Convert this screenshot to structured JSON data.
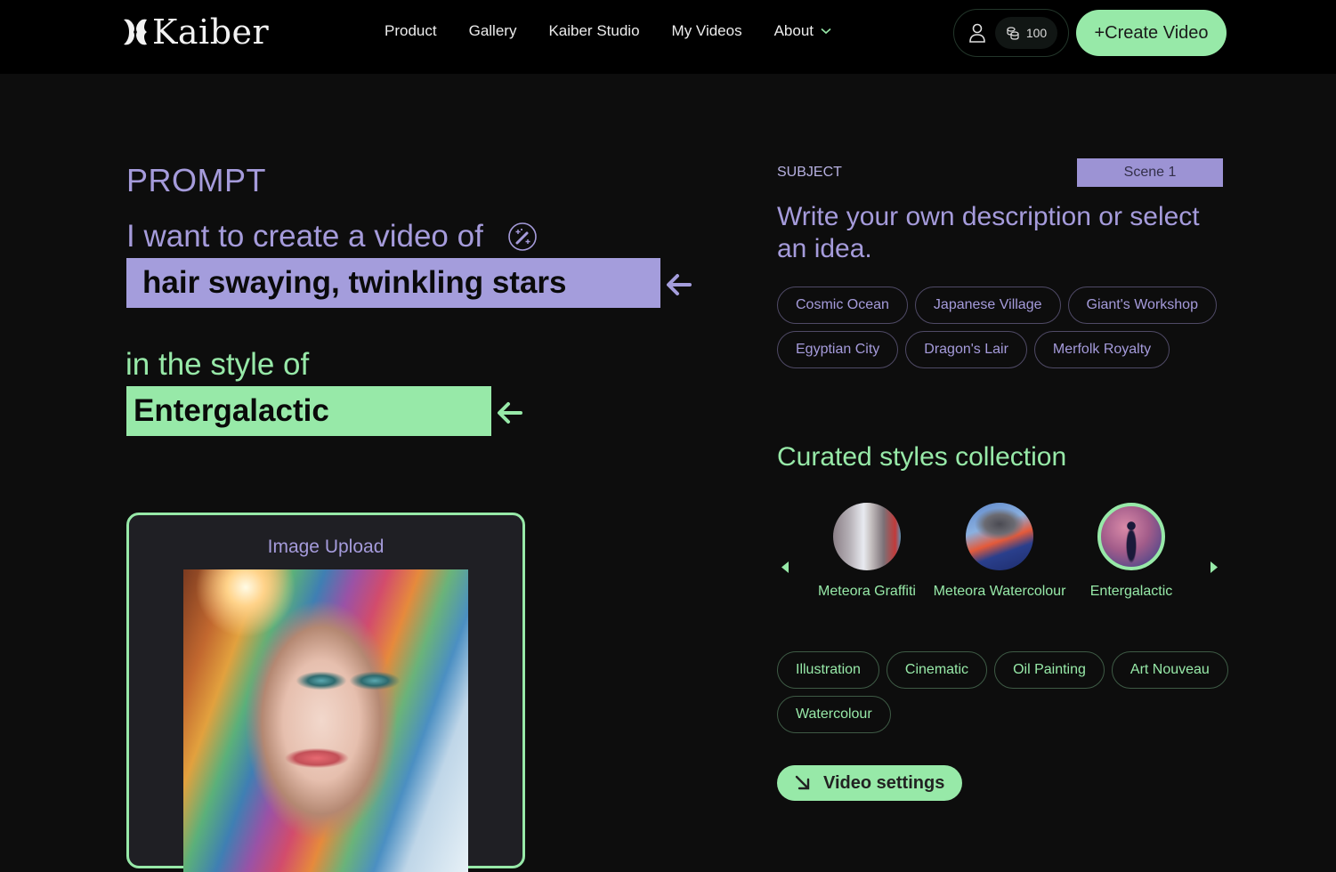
{
  "header": {
    "logo_text": "Kaiber",
    "nav": [
      "Product",
      "Gallery",
      "Kaiber Studio",
      "My Videos",
      "About"
    ],
    "credits": "100",
    "create_button": "+Create Video"
  },
  "prompt": {
    "label": "PROMPT",
    "intro": "I want to create a video of",
    "subject_value": "hair swaying, twinkling stars",
    "style_intro": "in the style of",
    "style_value": "Entergalactic"
  },
  "upload": {
    "title": "Image Upload"
  },
  "subject": {
    "label": "SUBJECT",
    "scene_tab": "Scene 1",
    "description": "Write your own description or select an idea.",
    "ideas": [
      "Cosmic Ocean",
      "Japanese Village",
      "Giant's Workshop",
      "Egyptian City",
      "Dragon's Lair",
      "Merfolk Royalty"
    ]
  },
  "styles": {
    "title": "Curated styles collection",
    "collection": [
      {
        "name": "Meteora Graffiti",
        "selected": false
      },
      {
        "name": "Meteora Watercolour",
        "selected": false
      },
      {
        "name": "Entergalactic",
        "selected": true
      }
    ],
    "tags": [
      "Illustration",
      "Cinematic",
      "Oil Painting",
      "Art Nouveau",
      "Watercolour"
    ]
  },
  "video_settings_button": "Video settings",
  "colors": {
    "accent_green": "#97e9a8",
    "accent_purple": "#a49ddc",
    "background": "#0d0d0d",
    "header": "#000000"
  }
}
